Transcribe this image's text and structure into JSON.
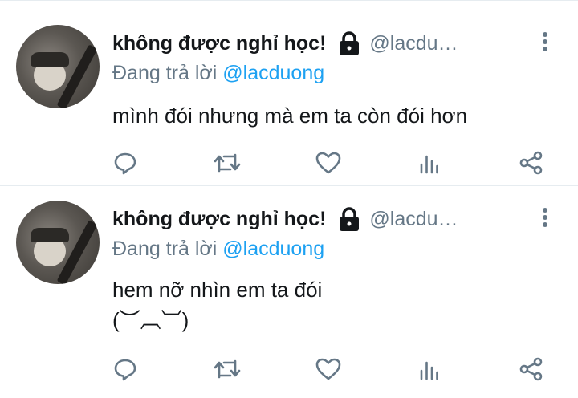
{
  "tweets": [
    {
      "author_name": "không được nghỉ học!",
      "handle": "@lacdu…",
      "replying_prefix": "Đang trả lời ",
      "replying_mention": "@lacduong",
      "text": "mình đói nhưng mà em ta còn đói hơn"
    },
    {
      "author_name": "không được nghỉ học!",
      "handle": "@lacdu…",
      "replying_prefix": "Đang trả lời ",
      "replying_mention": "@lacduong",
      "text": "hem nỡ nhìn em ta đói\n(︶︹︺)"
    }
  ],
  "icons": [
    "lock-icon",
    "more-vertical-icon",
    "reply-icon",
    "retweet-icon",
    "like-icon",
    "analytics-icon",
    "share-icon"
  ],
  "colors": {
    "text": "#14171a",
    "secondary": "#657786",
    "link": "#1da1f2",
    "divider": "#e6ecf0"
  }
}
